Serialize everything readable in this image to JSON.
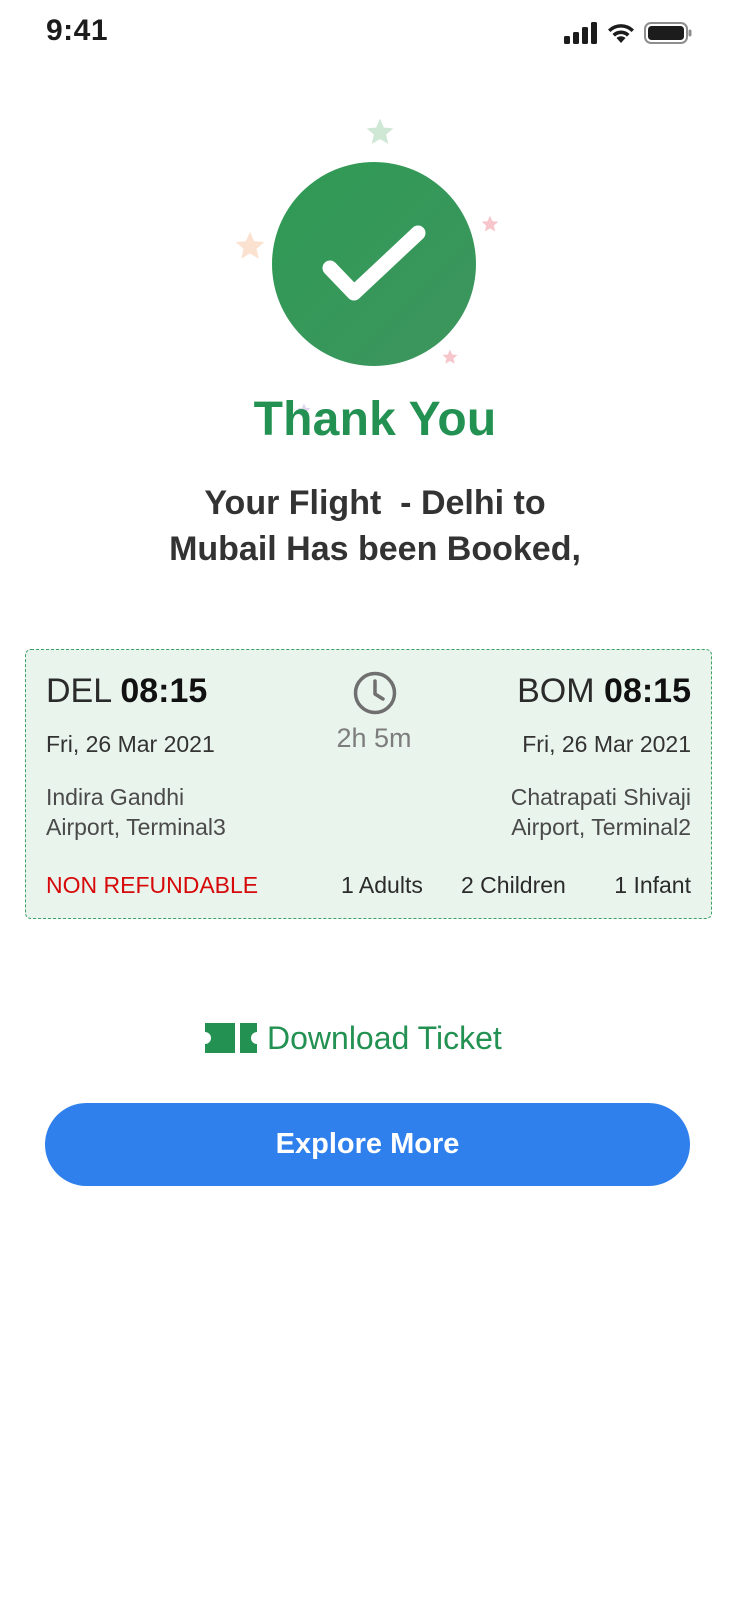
{
  "status_bar": {
    "time": "9:41"
  },
  "confirmation": {
    "title": "Thank You",
    "message_line1": "Your Flight  - Delhi to",
    "message_line2": "Mubail Has been Booked,"
  },
  "flight": {
    "departure": {
      "code": "DEL",
      "time": "08:15",
      "date": "Fri, 26 Mar 2021",
      "airport_line1": "Indira Gandhi",
      "airport_line2": "Airport, Terminal3"
    },
    "arrival": {
      "code": "BOM",
      "time": "08:15",
      "date": "Fri, 26 Mar 2021",
      "airport_line1": "Chatrapati Shivaji",
      "airport_line2": "Airport, Terminal2"
    },
    "duration": "2h 5m",
    "refund_status": "NON REFUNDABLE",
    "passengers": {
      "adults": "1 Adults",
      "children": "2 Children",
      "infants": "1 Infant"
    }
  },
  "actions": {
    "download_label": "Download Ticket",
    "explore_label": "Explore More"
  },
  "icons": {
    "signal": "signal-icon",
    "wifi": "wifi-icon",
    "battery": "battery-icon",
    "check": "check-icon",
    "clock": "clock-icon",
    "ticket": "ticket-icon"
  },
  "colors": {
    "brand_green": "#239152",
    "accent_blue": "#2f80ec",
    "refund_red": "#d60a0a",
    "card_bg": "#e9f4ed"
  }
}
